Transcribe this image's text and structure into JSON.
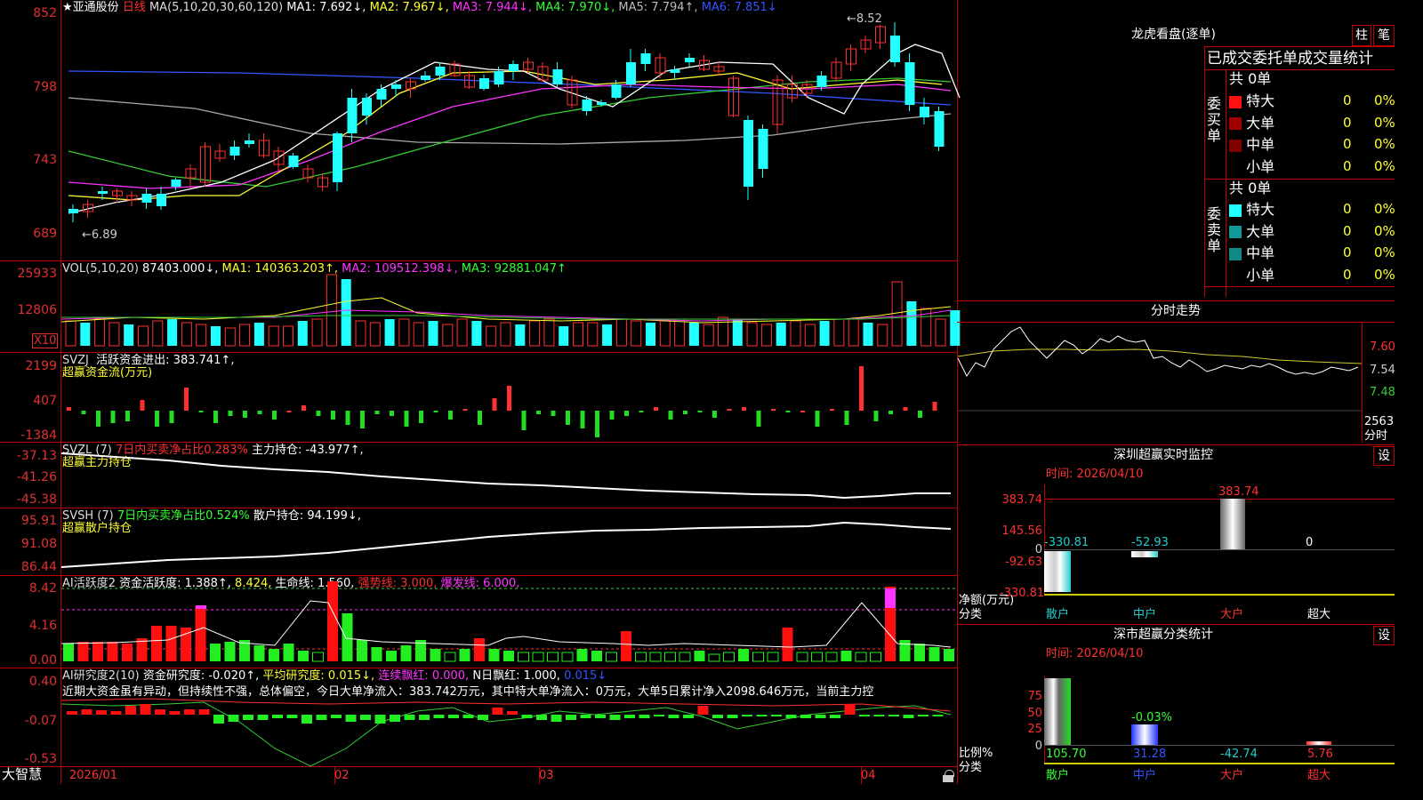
{
  "header": {
    "star": "★",
    "stock_name": "亚通股份",
    "period": "日线",
    "ma_params": "MA(5,10,20,30,60,120)",
    "ma1": "MA1: 7.692↓,",
    "ma2": "MA2: 7.967↓,",
    "ma3": "MA3: 7.944↓,",
    "ma4": "MA4: 7.970↓,",
    "ma5": "MA5: 7.794↑,",
    "ma6": "MA6: 7.851↓"
  },
  "price_axis": [
    "852",
    "798",
    "743",
    "689"
  ],
  "price_marks": {
    "high": "8.52",
    "low": "6.89"
  },
  "vol_header": {
    "params": "VOL(5,10,20)",
    "vol": "87403.000↓,",
    "ma1": "MA1: 140363.203↑,",
    "ma2": "MA2: 109512.398↓,",
    "ma3": "MA3: 92881.047↑"
  },
  "vol_axis": [
    "25933",
    "12806",
    "X10"
  ],
  "svzj": {
    "name": "SVZJ",
    "label": "活跃资金进出: 383.741↑,",
    "sub": "超赢资金流(万元)",
    "axis": [
      "2199",
      "407",
      "-1384"
    ]
  },
  "svzl": {
    "name": "SVZL (7)",
    "ratio": "7日内买卖净占比0.283%",
    "hold": "主力持仓: -43.977↑,",
    "sub": "超赢主力持仓",
    "axis": [
      "-37.13",
      "-41.26",
      "-45.38"
    ]
  },
  "svsh": {
    "name": "SVSH (7)",
    "ratio": "7日内买卖净占比0.524%",
    "hold": "散户持仓: 94.199↓,",
    "sub": "超赢散户持仓",
    "axis": [
      "95.91",
      "91.08",
      "86.44"
    ]
  },
  "ai_active": {
    "name": "AI活跃度2",
    "active": "资金活跃度: 1.388↑,",
    "v2": "8.424,",
    "life": "生命线: 1.560,",
    "strong": "强势线: 3.000,",
    "burst": "爆发线: 6.000,",
    "axis": [
      "8.42",
      "4.16",
      "0.00"
    ]
  },
  "ai_research": {
    "name": "AI研究度2(10)",
    "res": "资金研究度: -0.020↑,",
    "avg": "平均研究度: 0.015↓,",
    "cont": "连续飘红: 0.000,",
    "nday": "N日飘红: 1.000,",
    "last": "0.015↓",
    "comment": "近期大资金虽有异动，但持续性不强，总体偏空，今日大单净流入：383.742万元，其中特大单净流入：0万元，大单5日累计净入2098.646万元，当前主力控",
    "axis": [
      "0.40",
      "-0.07",
      "-0.53"
    ]
  },
  "bottom": {
    "brand": "大智慧",
    "dates": [
      "2026/01",
      "02",
      "03",
      "04"
    ]
  },
  "right": {
    "title": "龙虎看盘(逐单)",
    "btn_zhu": "柱",
    "btn_bi": "笔",
    "stat_title": "已成交委托单成交量统计",
    "buy_label": "委买单",
    "sell_label": "委卖单",
    "buy_total": "共 0单",
    "sell_total": "共 0单",
    "rows": [
      {
        "name": "特大",
        "v": "0",
        "p": "0%"
      },
      {
        "name": "大单",
        "v": "0",
        "p": "0%"
      },
      {
        "name": "中单",
        "v": "0",
        "p": "0%"
      },
      {
        "name": "小单",
        "v": "0",
        "p": "0%"
      }
    ],
    "intraday_title": "分时走势",
    "intraday_axis": [
      "7.60",
      "7.54",
      "7.48",
      "2563",
      "分时"
    ],
    "monitor_title": "深圳超赢实时监控",
    "set_btn": "设",
    "time_label": "时间: 2026/04/10",
    "monitor_axis": [
      "383.74",
      "145.56",
      "0",
      "-92.63",
      "-330.81"
    ],
    "monitor_vals": {
      "retail": "-330.81",
      "mid": "-52.93",
      "big": "383.74",
      "super": "0"
    },
    "net_label": "净额(万元)",
    "class_label": "分类",
    "cats": [
      "散户",
      "中户",
      "大户",
      "超大"
    ],
    "stat2_title": "深市超赢分类统计",
    "time2_label": "时间: 2026/04/10",
    "stat2_axis": [
      "75",
      "50",
      "25",
      "0"
    ],
    "stat2_mid_pct": "-0.03%",
    "ratio_label": "比例%",
    "stat2_vals": [
      "105.70",
      "31.28",
      "-42.74",
      "5.76"
    ]
  }
}
